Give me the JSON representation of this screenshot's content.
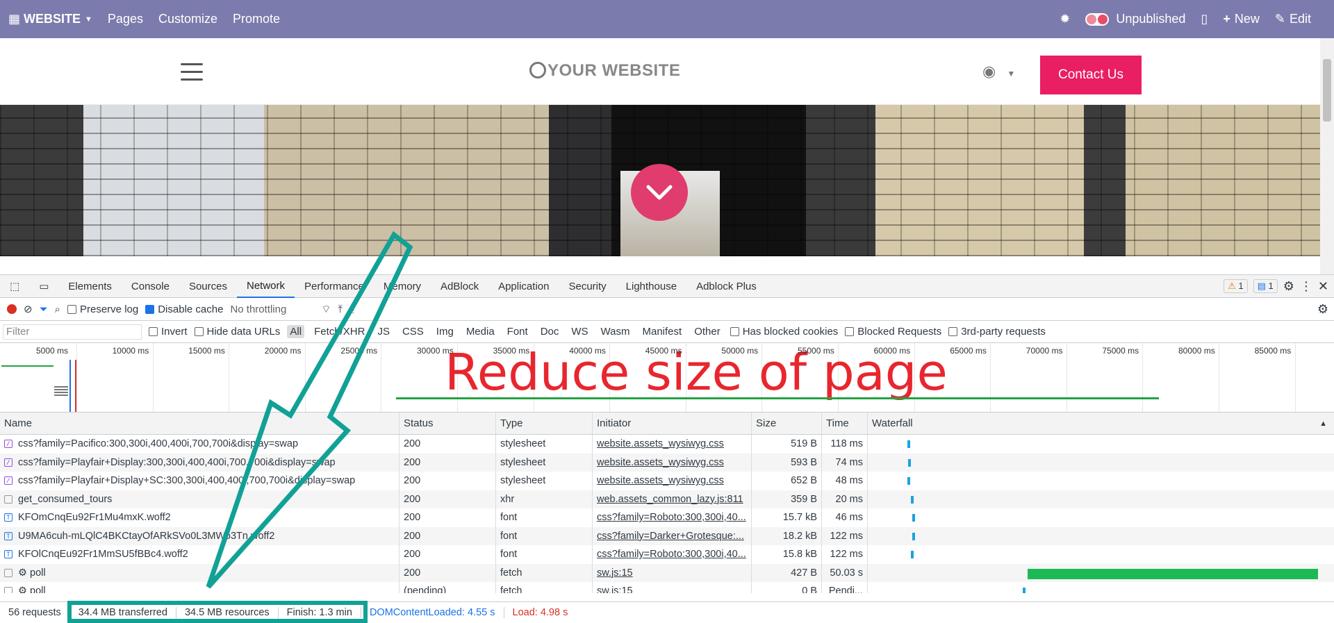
{
  "topbar": {
    "brand": "WEBSITE",
    "menu": [
      "Pages",
      "Customize",
      "Promote"
    ],
    "publish_state": "Unpublished",
    "new_label": "New",
    "edit_label": "Edit"
  },
  "site": {
    "logo_text": "YOUR WEBSITE",
    "contact_label": "Contact Us"
  },
  "devtools": {
    "tabs": [
      "Elements",
      "Console",
      "Sources",
      "Network",
      "Performance",
      "Memory",
      "AdBlock",
      "Application",
      "Security",
      "Lighthouse",
      "Adblock Plus"
    ],
    "active_tab": "Network",
    "warn_count": "1",
    "msg_count": "1",
    "toolbar": {
      "preserve_log": "Preserve log",
      "disable_cache": "Disable cache",
      "throttling": "No throttling"
    },
    "filter": {
      "placeholder": "Filter",
      "invert": "Invert",
      "hide_data_urls": "Hide data URLs",
      "types": [
        "All",
        "Fetch/XHR",
        "JS",
        "CSS",
        "Img",
        "Media",
        "Font",
        "Doc",
        "WS",
        "Wasm",
        "Manifest",
        "Other"
      ],
      "has_blocked_cookies": "Has blocked cookies",
      "blocked_requests": "Blocked Requests",
      "third_party": "3rd-party requests"
    },
    "timeline_ticks": [
      "5000 ms",
      "10000 ms",
      "15000 ms",
      "20000 ms",
      "25000 ms",
      "30000 ms",
      "35000 ms",
      "40000 ms",
      "45000 ms",
      "50000 ms",
      "55000 ms",
      "60000 ms",
      "65000 ms",
      "70000 ms",
      "75000 ms",
      "80000 ms",
      "85000 ms"
    ],
    "columns": [
      "Name",
      "Status",
      "Type",
      "Initiator",
      "Size",
      "Time",
      "Waterfall"
    ],
    "rows": [
      {
        "name": "css?family=Pacifico:300,300i,400,400i,700,700i&display=swap",
        "status": "200",
        "type": "stylesheet",
        "initiator": "website.assets_wysiwyg.css",
        "size": "519 B",
        "time": "118 ms",
        "icon": "css"
      },
      {
        "name": "css?family=Playfair+Display:300,300i,400,400i,700,700i&display=swap",
        "status": "200",
        "type": "stylesheet",
        "initiator": "website.assets_wysiwyg.css",
        "size": "593 B",
        "time": "74 ms",
        "icon": "css"
      },
      {
        "name": "css?family=Playfair+Display+SC:300,300i,400,400i,700,700i&display=swap",
        "status": "200",
        "type": "stylesheet",
        "initiator": "website.assets_wysiwyg.css",
        "size": "652 B",
        "time": "48 ms",
        "icon": "css"
      },
      {
        "name": "get_consumed_tours",
        "status": "200",
        "type": "xhr",
        "initiator": "web.assets_common_lazy.js:811",
        "size": "359 B",
        "time": "20 ms",
        "icon": "doc"
      },
      {
        "name": "KFOmCnqEu92Fr1Mu4mxK.woff2",
        "status": "200",
        "type": "font",
        "initiator": "css?family=Roboto:300,300i,40...",
        "size": "15.7 kB",
        "time": "46 ms",
        "icon": "font"
      },
      {
        "name": "U9MA6cuh-mLQlC4BKCtayOfARkSVo0L3MWo3Tn.woff2",
        "status": "200",
        "type": "font",
        "initiator": "css?family=Darker+Grotesque:...",
        "size": "18.2 kB",
        "time": "122 ms",
        "icon": "font"
      },
      {
        "name": "KFOlCnqEu92Fr1MmSU5fBBc4.woff2",
        "status": "200",
        "type": "font",
        "initiator": "css?family=Roboto:300,300i,40...",
        "size": "15.8 kB",
        "time": "122 ms",
        "icon": "font"
      },
      {
        "name": "⚙ poll",
        "status": "200",
        "type": "fetch",
        "initiator": "sw.js:15",
        "size": "427 B",
        "time": "50.03 s",
        "icon": "doc"
      },
      {
        "name": "⚙ poll",
        "status": "(pending)",
        "type": "fetch",
        "initiator": "sw.js:15",
        "size": "0 B",
        "time": "Pendi...",
        "icon": "doc"
      }
    ],
    "summary": {
      "requests": "56 requests",
      "transferred": "34.4 MB transferred",
      "resources": "34.5 MB resources",
      "finish": "Finish: 1.3 min",
      "dom_loaded": "DOMContentLoaded: 4.55 s",
      "load": "Load: 4.98 s"
    }
  },
  "annotation": {
    "text": "Reduce size of page",
    "text_color": "#e8262e",
    "arrow_color": "#11a196"
  }
}
